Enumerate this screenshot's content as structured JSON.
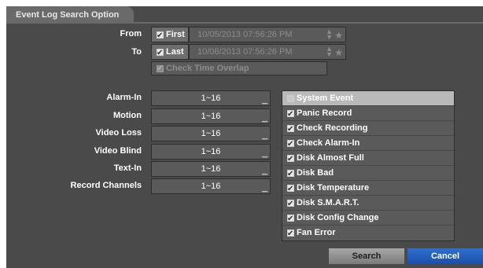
{
  "title": "Event Log Search Option",
  "from": {
    "label": "From",
    "checkbox_label": "First",
    "checked": true,
    "datetime": "10/05/2013  07:56:26 PM"
  },
  "to": {
    "label": "To",
    "checkbox_label": "Last",
    "checked": true,
    "datetime": "10/08/2013  07:56:26 PM"
  },
  "check_time_overlap": {
    "label": "Check Time Overlap",
    "checked": true
  },
  "filters": [
    {
      "label": "Alarm-In",
      "value": "1~16"
    },
    {
      "label": "Motion",
      "value": "1~16"
    },
    {
      "label": "Video Loss",
      "value": "1~16"
    },
    {
      "label": "Video Blind",
      "value": "1~16"
    },
    {
      "label": "Text-In",
      "value": "1~16"
    },
    {
      "label": "Record Channels",
      "value": "1~16"
    }
  ],
  "system_event": {
    "header": "System Event",
    "items": [
      {
        "label": "Panic Record",
        "checked": true
      },
      {
        "label": "Check Recording",
        "checked": true
      },
      {
        "label": "Check Alarm-In",
        "checked": true
      },
      {
        "label": "Disk Almost Full",
        "checked": true
      },
      {
        "label": "Disk Bad",
        "checked": true
      },
      {
        "label": "Disk Temperature",
        "checked": true
      },
      {
        "label": "Disk S.M.A.R.T.",
        "checked": true
      },
      {
        "label": "Disk Config Change",
        "checked": true
      },
      {
        "label": "Fan Error",
        "checked": true
      }
    ]
  },
  "buttons": {
    "search": "Search",
    "cancel": "Cancel"
  },
  "colors": {
    "panel": "#4a4a4a",
    "field": "#5a5a5a",
    "cancel": "#1b4fa8"
  }
}
